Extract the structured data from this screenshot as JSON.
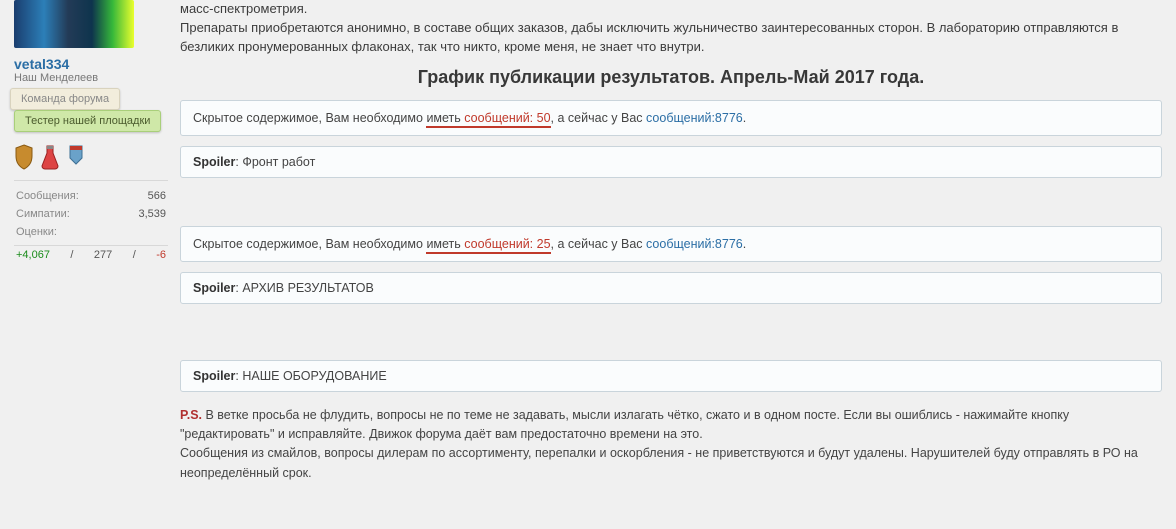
{
  "user": {
    "name": "vetal334",
    "subtitle": "Наш Менделеев",
    "tag_team": "Команда форума",
    "tag_tester": "Тестер нашей площадки",
    "stats": {
      "posts_label": "Сообщения:",
      "posts_value": "566",
      "likes_label": "Симпатии:",
      "likes_value": "3,539",
      "marks_label": "Оценки:"
    },
    "rep": {
      "pos": "+4,067",
      "neu": "277",
      "neg": "-6"
    }
  },
  "post": {
    "p0": "масс-спектрометрия.",
    "p1": "Препараты приобретаются анонимно, в составе общих заказов, дабы исключить жульничество заинтересованных сторон. В лабораторию отправляются в безликих пронумерованных флаконах, так что никто, кроме меня, не знает что внутри.",
    "heading": "График публикации результатов. Апрель-Май 2017 года.",
    "hidden1": {
      "pre": "Скрытое содержимое, Вам необходимо ",
      "have": "иметь ",
      "req": "сообщений: 50",
      "mid": ", а сейчас у Вас ",
      "cur": "сообщений:8776",
      "end": "."
    },
    "spoiler_label": "Spoiler",
    "spoiler1_title": "Фронт работ",
    "hidden2": {
      "pre": "Скрытое содержимое, Вам необходимо ",
      "have": "иметь ",
      "req": "сообщений: 25",
      "mid": ", а сейчас у Вас ",
      "cur": "сообщений:8776",
      "end": "."
    },
    "spoiler2_title": "АРХИВ РЕЗУЛЬТАТОВ",
    "spoiler3_title": "НАШЕ ОБОРУДОВАНИЕ",
    "ps_label": "P.S.",
    "ps1": " В ветке просьба не флудить, вопросы не по теме не задавать, мысли излагать чётко, сжато и в одном посте. Если вы ошиблись - нажимайте кнопку \"редактировать\" и исправляйте. Движок форума даёт вам предостаточно времени на это.",
    "ps2": "Сообщения из смайлов, вопросы дилерам по ассортименту, перепалки и оскорбления - не приветствуются и будут удалены. Нарушителей буду отправлять в РО на неопределённый срок."
  }
}
